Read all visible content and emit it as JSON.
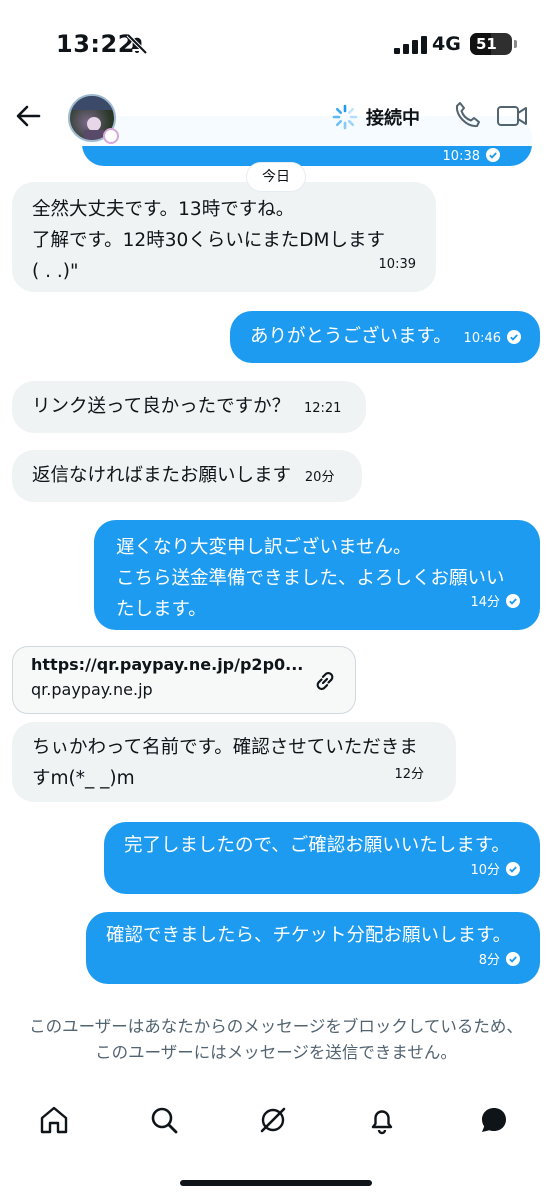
{
  "status_bar": {
    "time": "13:22",
    "network": "4G",
    "battery": "51",
    "battery_level": 0.51
  },
  "header": {
    "connecting_label": "接続中"
  },
  "chat": {
    "prev_time": "10:38",
    "date_separator": "今日",
    "messages": [
      {
        "from": "them",
        "lines": [
          "全然大丈夫です。13時ですね。",
          "了解です。12時30くらいにまたDMします",
          "(  . .)\""
        ],
        "time": "10:39"
      },
      {
        "from": "me",
        "lines": [
          "ありがとうございます。"
        ],
        "time": "10:46"
      },
      {
        "from": "them",
        "lines": [
          "リンク送って良かったですか？"
        ],
        "time": "12:21"
      },
      {
        "from": "them",
        "lines": [
          "返信なければまたお願いします"
        ],
        "time": "20分"
      },
      {
        "from": "me",
        "lines": [
          "遅くなり大変申し訳ございません。",
          "こちら送金準備できました、よろしくお願いい",
          "たします。"
        ],
        "time": "14分"
      },
      {
        "from": "them",
        "lines": [
          "ちぃかわって名前です。確認させていただきま",
          "すm(*_ _)m"
        ],
        "time": "12分"
      },
      {
        "from": "me",
        "lines": [
          "完了しましたので、ご確認お願いいたします。"
        ],
        "time": "10分"
      },
      {
        "from": "me",
        "lines": [
          "確認できましたら、チケット分配お願いします。"
        ],
        "time": "8分"
      }
    ],
    "link_card": {
      "url": "https://qr.paypay.ne.jp/p2p0...",
      "domain": "qr.paypay.ne.jp"
    },
    "blocked_notice": "このユーザーはあなたからのメッセージをブロックしているため、このユーザーにはメッセージを送信できません。"
  },
  "colors": {
    "accent": "#1d9bf0",
    "incoming_bubble": "#eff3f4",
    "muted_text": "#536471"
  },
  "bottom_nav": [
    "home-icon",
    "search-icon",
    "grok-icon",
    "notifications-icon",
    "messages-icon"
  ]
}
